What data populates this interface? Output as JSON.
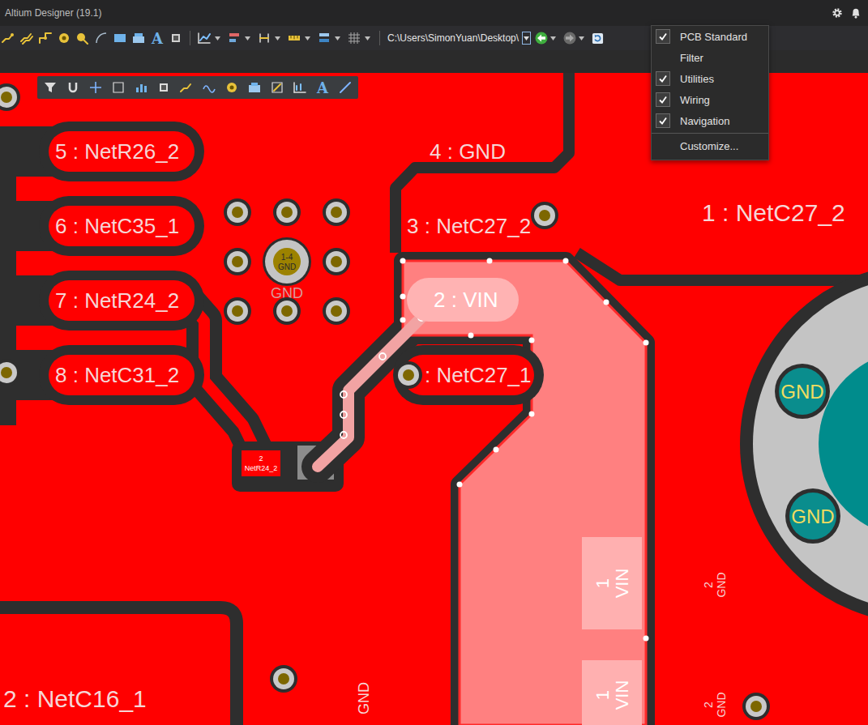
{
  "window": {
    "title": "Altium Designer (19.1)"
  },
  "toolbar": {
    "path": "C:\\Users\\SimonYuan\\Desktop\\",
    "text_tool": "A"
  },
  "floating_toolbar": {
    "text_tool": "A"
  },
  "menu": {
    "items": [
      {
        "label": "PCB Standard",
        "kind": "toggle",
        "checked": true
      },
      {
        "label": "Filter",
        "kind": "toggle",
        "checked": false
      },
      {
        "label": "Utilities",
        "kind": "toggle",
        "checked": true
      },
      {
        "label": "Wiring",
        "kind": "toggle",
        "checked": true
      },
      {
        "label": "Navigation",
        "kind": "toggle",
        "checked": true
      },
      {
        "label": "Customize...",
        "kind": "action",
        "checked": false
      }
    ]
  },
  "pcb": {
    "pill_pads": [
      {
        "label": "5 : NetR26_2",
        "highlighted": false
      },
      {
        "label": "6 : NetC35_1",
        "highlighted": false
      },
      {
        "label": "7 : NetR24_2",
        "highlighted": false
      },
      {
        "label": "8 : NetC31_2",
        "highlighted": false
      },
      {
        "label": "2 : VIN",
        "highlighted": true
      },
      {
        "label": ": NetC27_1",
        "highlighted": false
      }
    ],
    "pad_labels": [
      "4 : GND",
      "3 : NetC27_2",
      "1 : NetC27_2",
      "2 : NetC16_1"
    ],
    "via": {
      "layers": "1-4",
      "net": "GND",
      "caption": "GND"
    },
    "small_pad": {
      "number": "2",
      "net": "NetR24_2"
    },
    "mount_pads": [
      {
        "label": "GND"
      },
      {
        "label": "GND"
      }
    ],
    "vertical_pads": [
      {
        "number": "1",
        "net": "VIN",
        "highlighted": true
      },
      {
        "number": "1",
        "net": "VIN",
        "highlighted": true
      },
      {
        "number": "2",
        "net": "GND",
        "highlighted": false
      },
      {
        "number": "2",
        "net": "GND",
        "highlighted": false
      }
    ],
    "bottom_label": "GND",
    "selected_track": {
      "selected": true
    }
  }
}
